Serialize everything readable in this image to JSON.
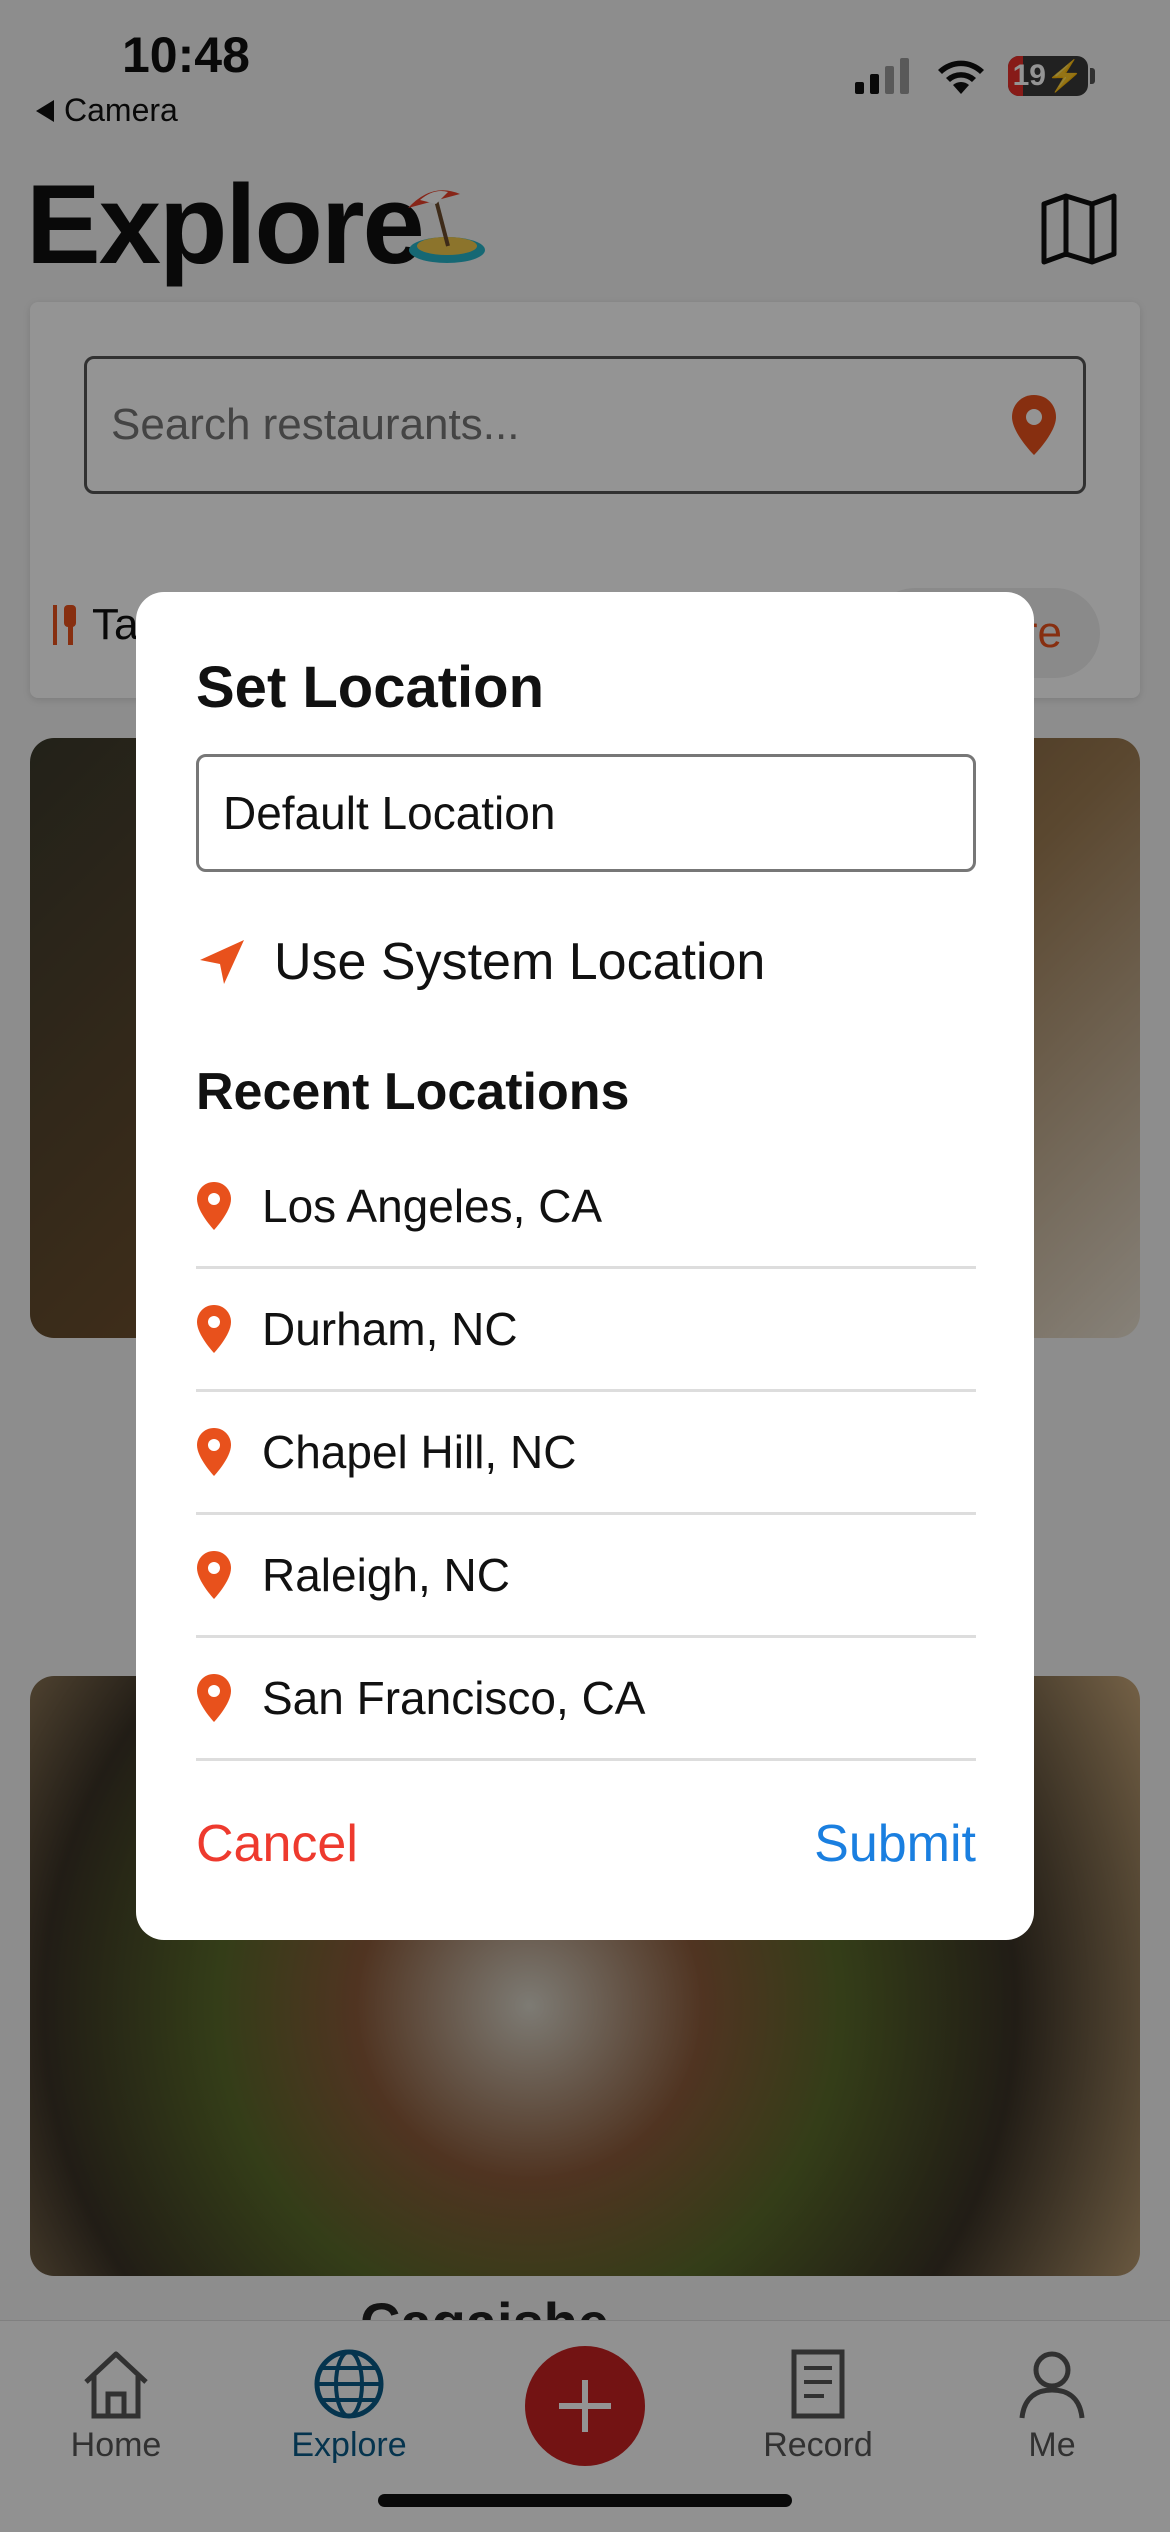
{
  "status_bar": {
    "time": "10:48",
    "back_app": "Camera",
    "battery": "19",
    "battery_level": 0.19
  },
  "header": {
    "title": "Explore",
    "beach_icon": "beach-umbrella-icon",
    "map_icon": "map-icon"
  },
  "search": {
    "placeholder": "Search restaurants...",
    "chip_left": "Ta",
    "chip_right": "re"
  },
  "feed": {
    "title_peek": "Cagaishe"
  },
  "modal": {
    "title": "Set Location",
    "location_value": "Default Location",
    "use_system_location": "Use System Location",
    "recent_heading": "Recent Locations",
    "recent": [
      {
        "label": "Los Angeles, CA"
      },
      {
        "label": "Durham, NC"
      },
      {
        "label": "Chapel Hill, NC"
      },
      {
        "label": "Raleigh, NC"
      },
      {
        "label": "San Francisco, CA"
      }
    ],
    "cancel_label": "Cancel",
    "submit_label": "Submit"
  },
  "tab_bar": {
    "tabs": [
      {
        "label": "Home",
        "icon": "house-icon"
      },
      {
        "label": "Explore",
        "icon": "globe-icon"
      },
      {
        "label": "Record",
        "icon": "receipt-icon"
      },
      {
        "label": "Me",
        "icon": "person-icon"
      }
    ],
    "add_icon": "plus-icon"
  },
  "colors": {
    "accent_orange": "#e8511c",
    "cancel_red": "#ee3a2e",
    "submit_blue": "#1a7fe0",
    "active_tab": "#0a5b87",
    "add_button": "#c62121"
  }
}
